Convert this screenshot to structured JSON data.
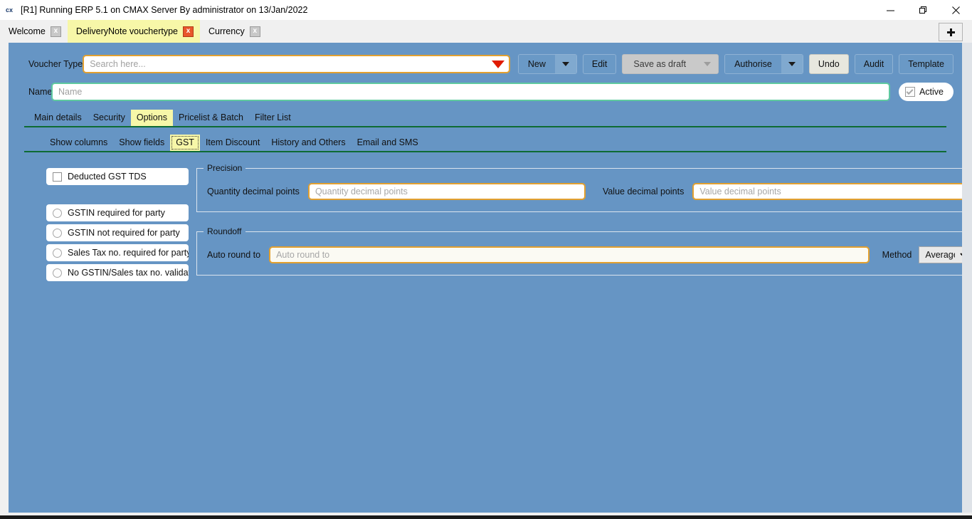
{
  "window": {
    "icon_label": "cx",
    "title": "[R1] Running ERP 5.1 on CMAX Server By administrator on 13/Jan/2022",
    "minimize_label": "Minimize",
    "restore_label": "Restore",
    "close_label": "Close"
  },
  "tabstrip": {
    "tabs": [
      {
        "label": "Welcome",
        "active": false,
        "close_label": "x"
      },
      {
        "label": "DeliveryNote vouchertype",
        "active": true,
        "close_label": "x"
      },
      {
        "label": "Currency",
        "active": false,
        "close_label": "x"
      }
    ],
    "new_tab_label": "+"
  },
  "header": {
    "voucher_type_label": "Voucher Type",
    "search_value": "",
    "search_placeholder": "Search here...",
    "name_label": "Name",
    "name_value": "",
    "name_placeholder": "Name",
    "active_label": "Active",
    "active_checked": true
  },
  "toolbar": {
    "new_label": "New",
    "edit_label": "Edit",
    "save_as_draft_label": "Save as draft",
    "authorise_label": "Authorise",
    "undo_label": "Undo",
    "audit_label": "Audit",
    "template_label": "Template"
  },
  "main_tabs": [
    {
      "label": "Main details",
      "active": false
    },
    {
      "label": "Security",
      "active": false
    },
    {
      "label": "Options",
      "active": true
    },
    {
      "label": "Pricelist & Batch",
      "active": false
    },
    {
      "label": "Filter List",
      "active": false
    }
  ],
  "sub_tabs": [
    {
      "label": "Show columns",
      "active": false
    },
    {
      "label": "Show fields",
      "active": false
    },
    {
      "label": "GST",
      "active": true
    },
    {
      "label": "Item Discount",
      "active": false
    },
    {
      "label": "History and Others",
      "active": false
    },
    {
      "label": "Email and SMS",
      "active": false
    }
  ],
  "options": {
    "deducted_gst_tds": {
      "label": "Deducted GST TDS",
      "checked": false
    },
    "party_validation": [
      {
        "label": "GSTIN required for party",
        "selected": false
      },
      {
        "label": "GSTIN not required for party",
        "selected": false
      },
      {
        "label": "Sales Tax no. required for party",
        "selected": false
      },
      {
        "label": "No GSTIN/Sales tax no. validation",
        "selected": false
      }
    ],
    "precision": {
      "title": "Precision",
      "quantity_label": "Quantity decimal points",
      "quantity_value": "",
      "quantity_placeholder": "Quantity decimal points",
      "value_label": "Value decimal points",
      "value_value": "",
      "value_placeholder": "Value decimal points"
    },
    "roundoff": {
      "title": "Roundoff",
      "auto_round_label": "Auto round to",
      "auto_round_value": "",
      "auto_round_placeholder": "Auto round to",
      "method_label": "Method",
      "method_value": "Average",
      "method_options": [
        "Average"
      ]
    }
  },
  "colors": {
    "app_background": "#6695c4",
    "accent_yellow": "#f7f7a8",
    "input_border_gold": "#e2a030",
    "input_border_green": "#5fc9a0",
    "separator_green": "#0e6b33",
    "close_red": "#e8562b"
  }
}
